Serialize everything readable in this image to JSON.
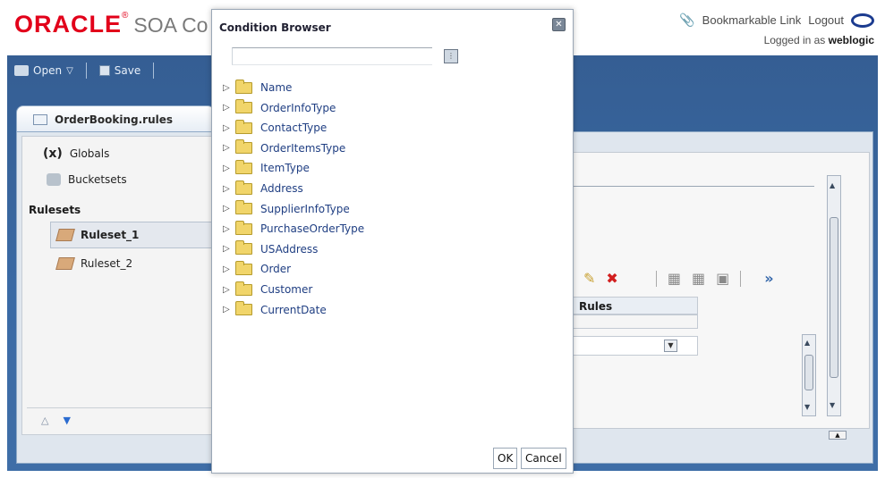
{
  "header": {
    "brand": "ORACLE",
    "trademark": "®",
    "product": "SOA Co",
    "bookmark_link": "Bookmarkable Link",
    "logout": "Logout",
    "logged_in_prefix": "Logged in as",
    "username": "weblogic"
  },
  "toolbar": {
    "open_label": "Open",
    "save_label": "Save"
  },
  "editor_tab": {
    "label": "OrderBooking.rules"
  },
  "left_panel": {
    "globals": "Globals",
    "globals_icon": "(x)",
    "bucketsets": "Bucketsets",
    "rulesets_header": "Rulesets",
    "rulesets": [
      "Ruleset_1",
      "Ruleset_2"
    ]
  },
  "right_panel": {
    "rules_column_header": "Rules",
    "more_chevron": "»"
  },
  "dialog": {
    "title": "Condition Browser",
    "search_value": "",
    "tree_items": [
      "Name",
      "OrderInfoType",
      "ContactType",
      "OrderItemsType",
      "ItemType",
      "Address",
      "SupplierInfoType",
      "PurchaseOrderType",
      "USAddress",
      "Order",
      "Customer",
      "CurrentDate"
    ],
    "ok_label": "OK",
    "cancel_label": "Cancel"
  },
  "colors": {
    "brand_red": "#e2001a",
    "band_blue": "#3a6aa5",
    "tree_link": "#1f3e82",
    "folder": "#f1d56a"
  }
}
